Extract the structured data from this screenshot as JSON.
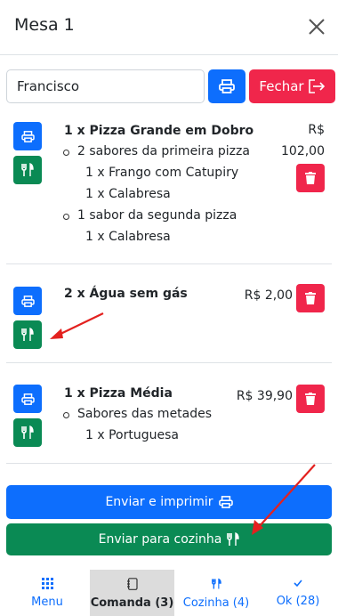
{
  "modal": {
    "title": "Mesa 1"
  },
  "customer": {
    "name": "Francisco"
  },
  "buttons": {
    "fechar": "Fechar",
    "enviar_imprimir": "Enviar e imprimir",
    "enviar_cozinha": "Enviar para cozinha"
  },
  "items": [
    {
      "title": "1 x Pizza Grande em Dobro",
      "price_currency": "R$",
      "price_value": "102,00",
      "lines": [
        "2 sabores da primeira pizza",
        "1 x Frango com Catupiry",
        "1 x Calabresa",
        "1 sabor da segunda pizza",
        "1 x Calabresa"
      ]
    },
    {
      "title": "2 x Água sem gás",
      "price": "R$ 2,00"
    },
    {
      "title": "1 x Pizza Média",
      "price": "R$ 39,90",
      "lines": [
        "Sabores das metades",
        "1 x Portuguesa"
      ]
    }
  ],
  "tabs": [
    {
      "label": "Menu",
      "icon": "grid-icon"
    },
    {
      "label": "Comanda (3)",
      "icon": "notepad-icon"
    },
    {
      "label": "Cozinha (4)",
      "icon": "utensils-icon"
    },
    {
      "label": "Ok (28)",
      "icon": "check-icon"
    }
  ],
  "colors": {
    "primary": "#0d6efd",
    "success": "#0a8a54",
    "danger": "#f0264b",
    "annotation": "#e3211f"
  }
}
